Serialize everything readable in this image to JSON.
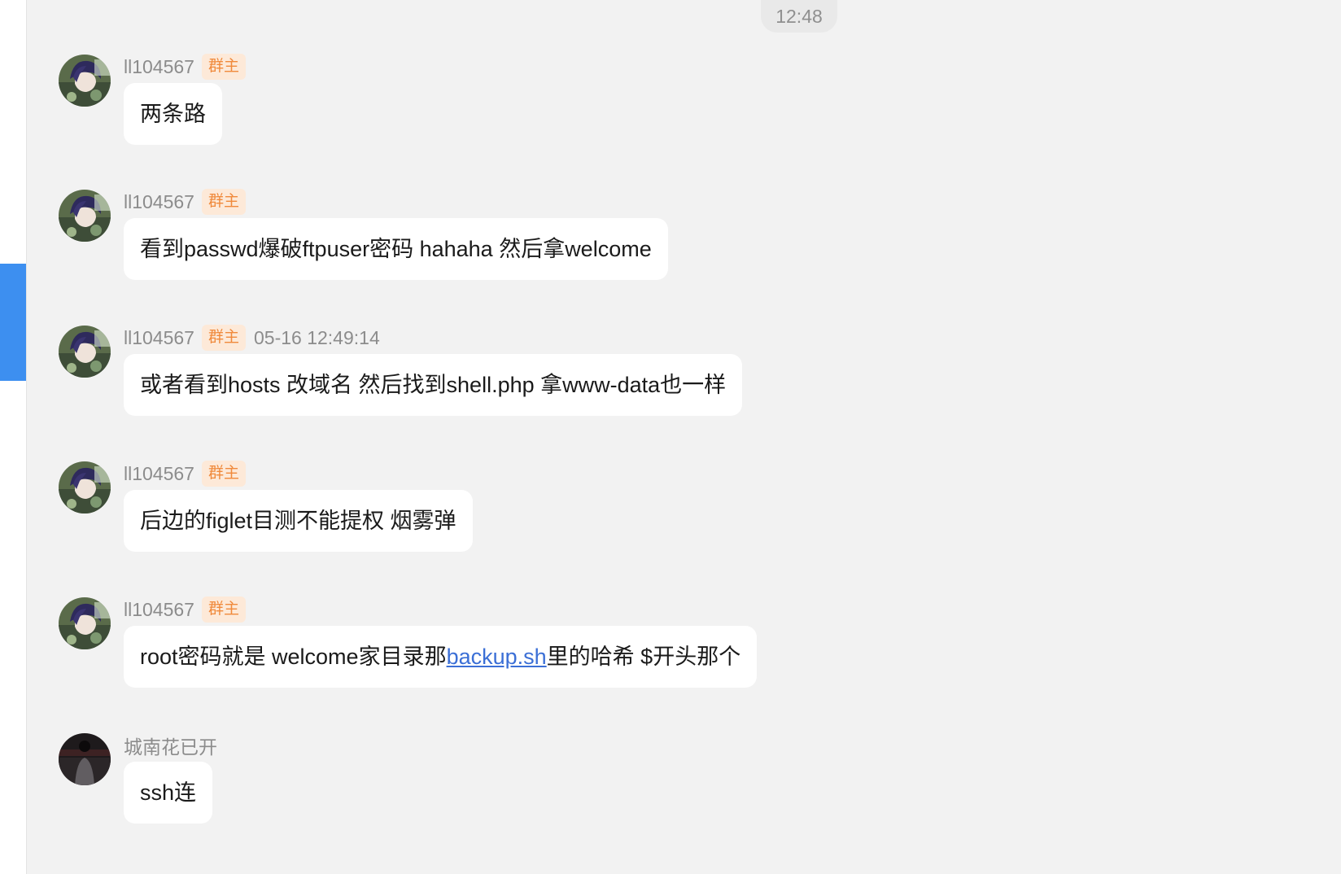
{
  "time_divider": "12:48",
  "accent_color": "#3d8ff0",
  "messages": [
    {
      "sender": "ll104567",
      "badge": "群主",
      "avatar": "anime-avatar",
      "text": "两条路"
    },
    {
      "sender": "ll104567",
      "badge": "群主",
      "avatar": "anime-avatar",
      "text": "看到passwd爆破ftpuser密码 hahaha 然后拿welcome"
    },
    {
      "sender": "ll104567",
      "badge": "群主",
      "timestamp": "05-16 12:49:14",
      "avatar": "anime-avatar",
      "text": "或者看到hosts 改域名 然后找到shell.php 拿www-data也一样"
    },
    {
      "sender": "ll104567",
      "badge": "群主",
      "avatar": "anime-avatar",
      "text": "后边的figlet目测不能提权 烟雾弹"
    },
    {
      "sender": "ll104567",
      "badge": "群主",
      "avatar": "anime-avatar",
      "text_before": "root密码就是 welcome家目录那",
      "link": "backup.sh",
      "text_after": "里的哈希 $开头那个"
    },
    {
      "sender": "城南花已开",
      "avatar": "dark-photo-avatar",
      "text": "ssh连"
    }
  ]
}
